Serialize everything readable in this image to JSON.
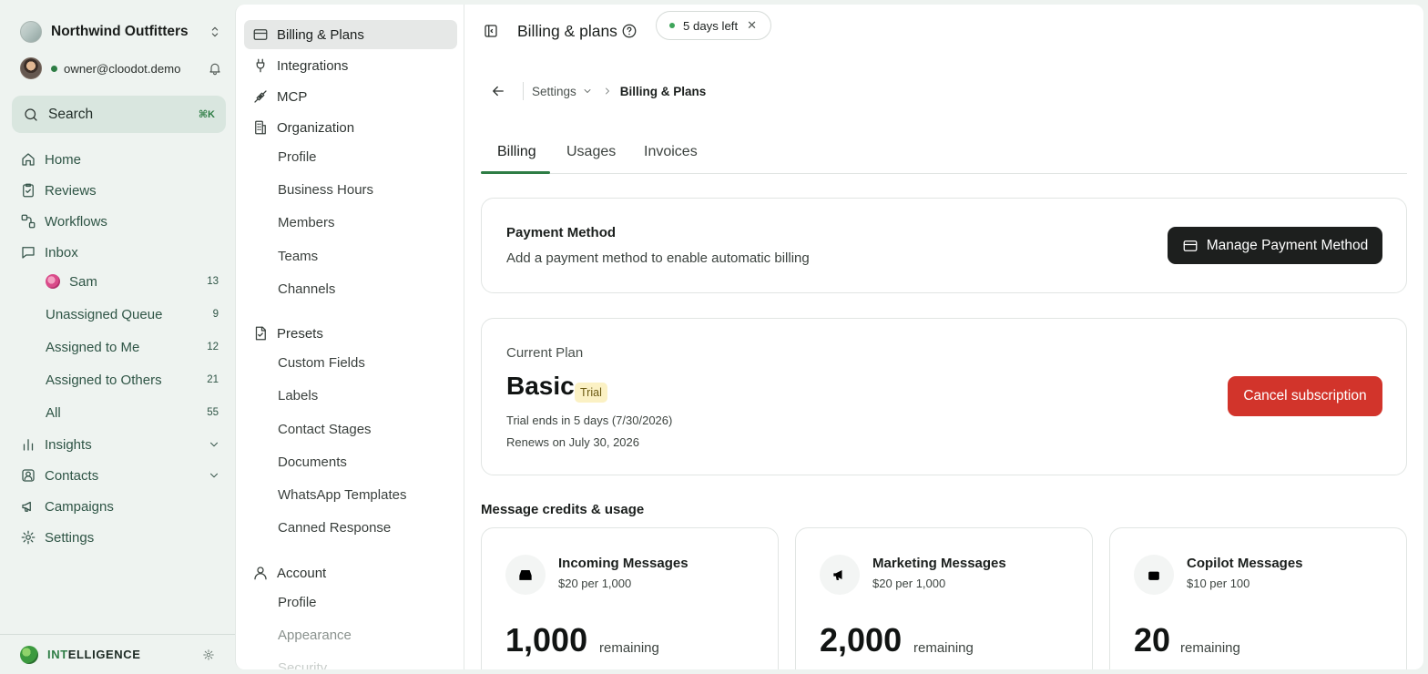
{
  "workspace": {
    "name": "Northwind Outfitters"
  },
  "user": {
    "email": "owner@cloodot.demo"
  },
  "search": {
    "label": "Search",
    "shortcut": "⌘K"
  },
  "nav": {
    "home": "Home",
    "reviews": "Reviews",
    "workflows": "Workflows",
    "inbox": "Inbox",
    "inbox_items": [
      {
        "label": "Sam",
        "count": "13"
      },
      {
        "label": "Unassigned Queue",
        "count": "9"
      },
      {
        "label": "Assigned to Me",
        "count": "12"
      },
      {
        "label": "Assigned to Others",
        "count": "21"
      },
      {
        "label": "All",
        "count": "55"
      }
    ],
    "insights": "Insights",
    "contacts": "Contacts",
    "campaigns": "Campaigns",
    "settings": "Settings"
  },
  "footer": {
    "brand_highlight": "INT",
    "brand_rest": "ELLIGENCE"
  },
  "settings_menu": {
    "billing": "Billing & Plans",
    "integrations": "Integrations",
    "mcp": "MCP",
    "organization": "Organization",
    "organization_items": [
      "Profile",
      "Business Hours",
      "Members",
      "Teams",
      "Channels"
    ],
    "presets": "Presets",
    "presets_items": [
      "Custom Fields",
      "Labels",
      "Contact Stages",
      "Documents",
      "WhatsApp Templates",
      "Canned Response"
    ],
    "account": "Account",
    "account_items": [
      "Profile",
      "Appearance",
      "Security"
    ]
  },
  "header": {
    "title": "Billing & plans",
    "trial_pill": "5 days left",
    "close_glyph": "✕"
  },
  "breadcrumb": {
    "parent": "Settings",
    "current": "Billing & Plans"
  },
  "tabs": [
    "Billing",
    "Usages",
    "Invoices"
  ],
  "payment_method": {
    "title": "Payment Method",
    "description": "Add a payment method to enable automatic billing",
    "button": "Manage Payment Method"
  },
  "plan": {
    "label": "Current Plan",
    "name": "Basic",
    "badge": "Trial",
    "trial_ends": "Trial ends in 5 days (7/30/2026)",
    "renews": "Renews on July 30, 2026",
    "cancel_button": "Cancel subscription"
  },
  "credits": {
    "title": "Message credits & usage",
    "cards": [
      {
        "title": "Incoming Messages",
        "price": "$20 per 1,000",
        "remaining": "1,000",
        "remaining_label": "remaining",
        "icon": "inbox-tray-icon"
      },
      {
        "title": "Marketing Messages",
        "price": "$20 per 1,000",
        "remaining": "2,000",
        "remaining_label": "remaining",
        "icon": "megaphone-icon"
      },
      {
        "title": "Copilot Messages",
        "price": "$10 per 100",
        "remaining": "20",
        "remaining_label": "remaining",
        "icon": "robot-icon"
      }
    ]
  },
  "colors": {
    "accent": "#2e7d45",
    "danger": "#d2342b",
    "dark_button": "#1d1f1e",
    "trial_badge": "#fbf1c4"
  }
}
